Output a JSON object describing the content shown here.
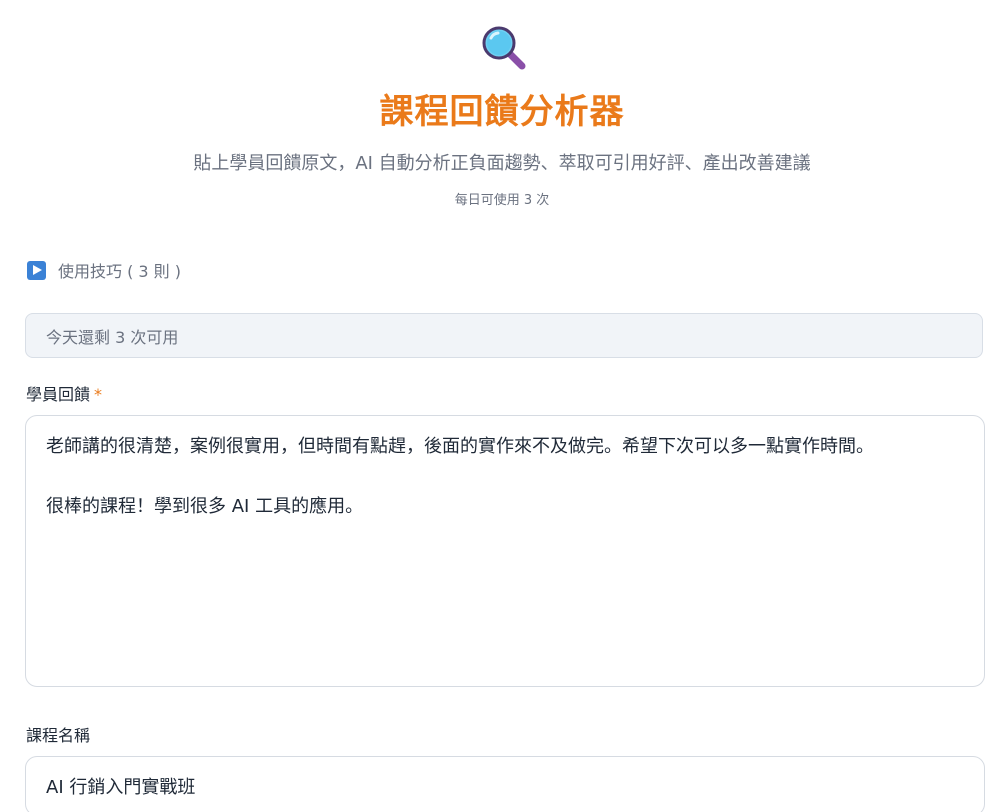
{
  "header": {
    "icon": "magnifying-glass-icon",
    "title": "課程回饋分析器",
    "subtitle": "貼上學員回饋原文，AI 自動分析正負面趨勢、萃取可引用好評、產出改善建議",
    "quota_note": "每日可使用 3 次"
  },
  "tips": {
    "icon": "play-square-icon",
    "label": "使用技巧 ( 3 則 )"
  },
  "remaining": {
    "text": "今天還剩 3 次可用"
  },
  "feedback": {
    "label": "學員回饋",
    "required_mark": "*",
    "value": "老師講的很清楚，案例很實用，但時間有點趕，後面的實作來不及做完。希望下次可以多一點實作時間。\n\n很棒的課程！學到很多 AI 工具的應用。"
  },
  "course": {
    "label": "課程名稱",
    "value": "AI 行銷入門實戰班"
  },
  "colors": {
    "title": "#ea7a1a",
    "accent_icon": "#3b82d6",
    "lens": "#5bc8f0",
    "handle": "#8a4fa8"
  }
}
